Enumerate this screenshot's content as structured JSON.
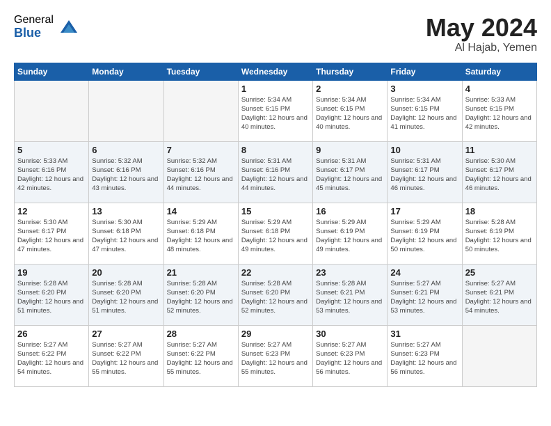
{
  "logo": {
    "general": "General",
    "blue": "Blue"
  },
  "title": {
    "month_year": "May 2024",
    "location": "Al Hajab, Yemen"
  },
  "days_of_week": [
    "Sunday",
    "Monday",
    "Tuesday",
    "Wednesday",
    "Thursday",
    "Friday",
    "Saturday"
  ],
  "weeks": [
    {
      "shaded": false,
      "days": [
        {
          "number": "",
          "sunrise": "",
          "sunset": "",
          "daylight": "",
          "empty": true
        },
        {
          "number": "",
          "sunrise": "",
          "sunset": "",
          "daylight": "",
          "empty": true
        },
        {
          "number": "",
          "sunrise": "",
          "sunset": "",
          "daylight": "",
          "empty": true
        },
        {
          "number": "1",
          "sunrise": "Sunrise: 5:34 AM",
          "sunset": "Sunset: 6:15 PM",
          "daylight": "Daylight: 12 hours and 40 minutes.",
          "empty": false
        },
        {
          "number": "2",
          "sunrise": "Sunrise: 5:34 AM",
          "sunset": "Sunset: 6:15 PM",
          "daylight": "Daylight: 12 hours and 40 minutes.",
          "empty": false
        },
        {
          "number": "3",
          "sunrise": "Sunrise: 5:34 AM",
          "sunset": "Sunset: 6:15 PM",
          "daylight": "Daylight: 12 hours and 41 minutes.",
          "empty": false
        },
        {
          "number": "4",
          "sunrise": "Sunrise: 5:33 AM",
          "sunset": "Sunset: 6:15 PM",
          "daylight": "Daylight: 12 hours and 42 minutes.",
          "empty": false
        }
      ]
    },
    {
      "shaded": true,
      "days": [
        {
          "number": "5",
          "sunrise": "Sunrise: 5:33 AM",
          "sunset": "Sunset: 6:16 PM",
          "daylight": "Daylight: 12 hours and 42 minutes.",
          "empty": false
        },
        {
          "number": "6",
          "sunrise": "Sunrise: 5:32 AM",
          "sunset": "Sunset: 6:16 PM",
          "daylight": "Daylight: 12 hours and 43 minutes.",
          "empty": false
        },
        {
          "number": "7",
          "sunrise": "Sunrise: 5:32 AM",
          "sunset": "Sunset: 6:16 PM",
          "daylight": "Daylight: 12 hours and 44 minutes.",
          "empty": false
        },
        {
          "number": "8",
          "sunrise": "Sunrise: 5:31 AM",
          "sunset": "Sunset: 6:16 PM",
          "daylight": "Daylight: 12 hours and 44 minutes.",
          "empty": false
        },
        {
          "number": "9",
          "sunrise": "Sunrise: 5:31 AM",
          "sunset": "Sunset: 6:17 PM",
          "daylight": "Daylight: 12 hours and 45 minutes.",
          "empty": false
        },
        {
          "number": "10",
          "sunrise": "Sunrise: 5:31 AM",
          "sunset": "Sunset: 6:17 PM",
          "daylight": "Daylight: 12 hours and 46 minutes.",
          "empty": false
        },
        {
          "number": "11",
          "sunrise": "Sunrise: 5:30 AM",
          "sunset": "Sunset: 6:17 PM",
          "daylight": "Daylight: 12 hours and 46 minutes.",
          "empty": false
        }
      ]
    },
    {
      "shaded": false,
      "days": [
        {
          "number": "12",
          "sunrise": "Sunrise: 5:30 AM",
          "sunset": "Sunset: 6:17 PM",
          "daylight": "Daylight: 12 hours and 47 minutes.",
          "empty": false
        },
        {
          "number": "13",
          "sunrise": "Sunrise: 5:30 AM",
          "sunset": "Sunset: 6:18 PM",
          "daylight": "Daylight: 12 hours and 47 minutes.",
          "empty": false
        },
        {
          "number": "14",
          "sunrise": "Sunrise: 5:29 AM",
          "sunset": "Sunset: 6:18 PM",
          "daylight": "Daylight: 12 hours and 48 minutes.",
          "empty": false
        },
        {
          "number": "15",
          "sunrise": "Sunrise: 5:29 AM",
          "sunset": "Sunset: 6:18 PM",
          "daylight": "Daylight: 12 hours and 49 minutes.",
          "empty": false
        },
        {
          "number": "16",
          "sunrise": "Sunrise: 5:29 AM",
          "sunset": "Sunset: 6:19 PM",
          "daylight": "Daylight: 12 hours and 49 minutes.",
          "empty": false
        },
        {
          "number": "17",
          "sunrise": "Sunrise: 5:29 AM",
          "sunset": "Sunset: 6:19 PM",
          "daylight": "Daylight: 12 hours and 50 minutes.",
          "empty": false
        },
        {
          "number": "18",
          "sunrise": "Sunrise: 5:28 AM",
          "sunset": "Sunset: 6:19 PM",
          "daylight": "Daylight: 12 hours and 50 minutes.",
          "empty": false
        }
      ]
    },
    {
      "shaded": true,
      "days": [
        {
          "number": "19",
          "sunrise": "Sunrise: 5:28 AM",
          "sunset": "Sunset: 6:20 PM",
          "daylight": "Daylight: 12 hours and 51 minutes.",
          "empty": false
        },
        {
          "number": "20",
          "sunrise": "Sunrise: 5:28 AM",
          "sunset": "Sunset: 6:20 PM",
          "daylight": "Daylight: 12 hours and 51 minutes.",
          "empty": false
        },
        {
          "number": "21",
          "sunrise": "Sunrise: 5:28 AM",
          "sunset": "Sunset: 6:20 PM",
          "daylight": "Daylight: 12 hours and 52 minutes.",
          "empty": false
        },
        {
          "number": "22",
          "sunrise": "Sunrise: 5:28 AM",
          "sunset": "Sunset: 6:20 PM",
          "daylight": "Daylight: 12 hours and 52 minutes.",
          "empty": false
        },
        {
          "number": "23",
          "sunrise": "Sunrise: 5:28 AM",
          "sunset": "Sunset: 6:21 PM",
          "daylight": "Daylight: 12 hours and 53 minutes.",
          "empty": false
        },
        {
          "number": "24",
          "sunrise": "Sunrise: 5:27 AM",
          "sunset": "Sunset: 6:21 PM",
          "daylight": "Daylight: 12 hours and 53 minutes.",
          "empty": false
        },
        {
          "number": "25",
          "sunrise": "Sunrise: 5:27 AM",
          "sunset": "Sunset: 6:21 PM",
          "daylight": "Daylight: 12 hours and 54 minutes.",
          "empty": false
        }
      ]
    },
    {
      "shaded": false,
      "days": [
        {
          "number": "26",
          "sunrise": "Sunrise: 5:27 AM",
          "sunset": "Sunset: 6:22 PM",
          "daylight": "Daylight: 12 hours and 54 minutes.",
          "empty": false
        },
        {
          "number": "27",
          "sunrise": "Sunrise: 5:27 AM",
          "sunset": "Sunset: 6:22 PM",
          "daylight": "Daylight: 12 hours and 55 minutes.",
          "empty": false
        },
        {
          "number": "28",
          "sunrise": "Sunrise: 5:27 AM",
          "sunset": "Sunset: 6:22 PM",
          "daylight": "Daylight: 12 hours and 55 minutes.",
          "empty": false
        },
        {
          "number": "29",
          "sunrise": "Sunrise: 5:27 AM",
          "sunset": "Sunset: 6:23 PM",
          "daylight": "Daylight: 12 hours and 55 minutes.",
          "empty": false
        },
        {
          "number": "30",
          "sunrise": "Sunrise: 5:27 AM",
          "sunset": "Sunset: 6:23 PM",
          "daylight": "Daylight: 12 hours and 56 minutes.",
          "empty": false
        },
        {
          "number": "31",
          "sunrise": "Sunrise: 5:27 AM",
          "sunset": "Sunset: 6:23 PM",
          "daylight": "Daylight: 12 hours and 56 minutes.",
          "empty": false
        },
        {
          "number": "",
          "sunrise": "",
          "sunset": "",
          "daylight": "",
          "empty": true
        }
      ]
    }
  ]
}
